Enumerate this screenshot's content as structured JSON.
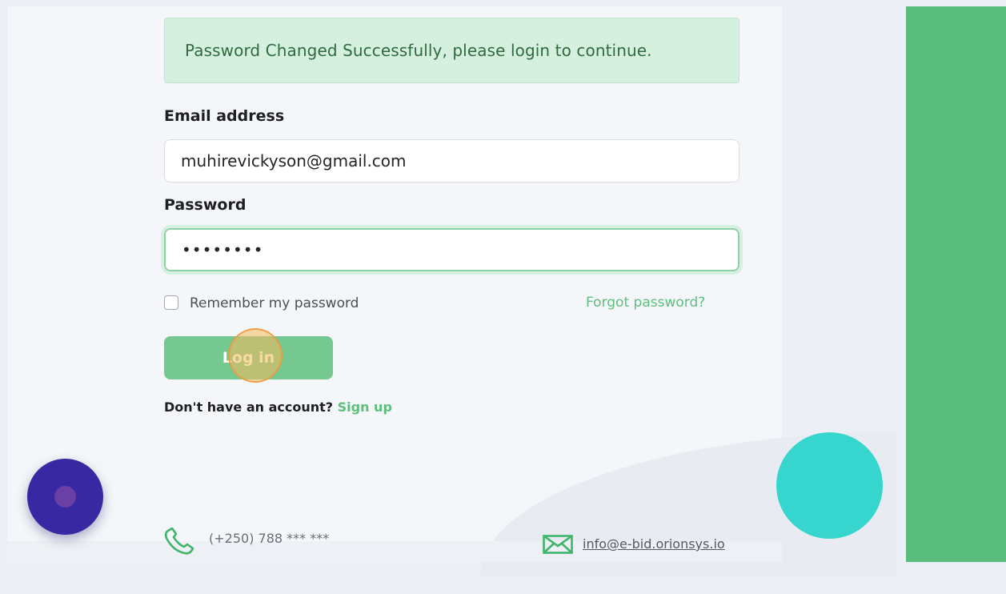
{
  "alert": {
    "message": "Password Changed Successfully, please login to continue."
  },
  "form": {
    "email_label": "Email address",
    "email_value": "muhirevickyson@gmail.com",
    "password_label": "Password",
    "password_value": "••••••••",
    "remember_label": "Remember my password",
    "remember_checked": false,
    "forgot_label": "Forgot password?",
    "login_label": "Log in",
    "no_account_text": "Don't have an account?",
    "signup_label": "Sign up"
  },
  "footer": {
    "phone": "(+250) 788 *** ***",
    "email": "info@e-bid.orionsys.io"
  },
  "colors": {
    "accent_green": "#5cbf7d",
    "button_green": "#74c890",
    "strip_green": "#59bd7d",
    "alert_bg": "#d6f0df",
    "alert_text": "#2f6b3f",
    "fab_purple": "#3829a3",
    "teal": "#36d6cf"
  },
  "icons": {
    "phone": "phone-icon",
    "mail": "mail-icon",
    "chat": "chat-launcher-icon"
  }
}
